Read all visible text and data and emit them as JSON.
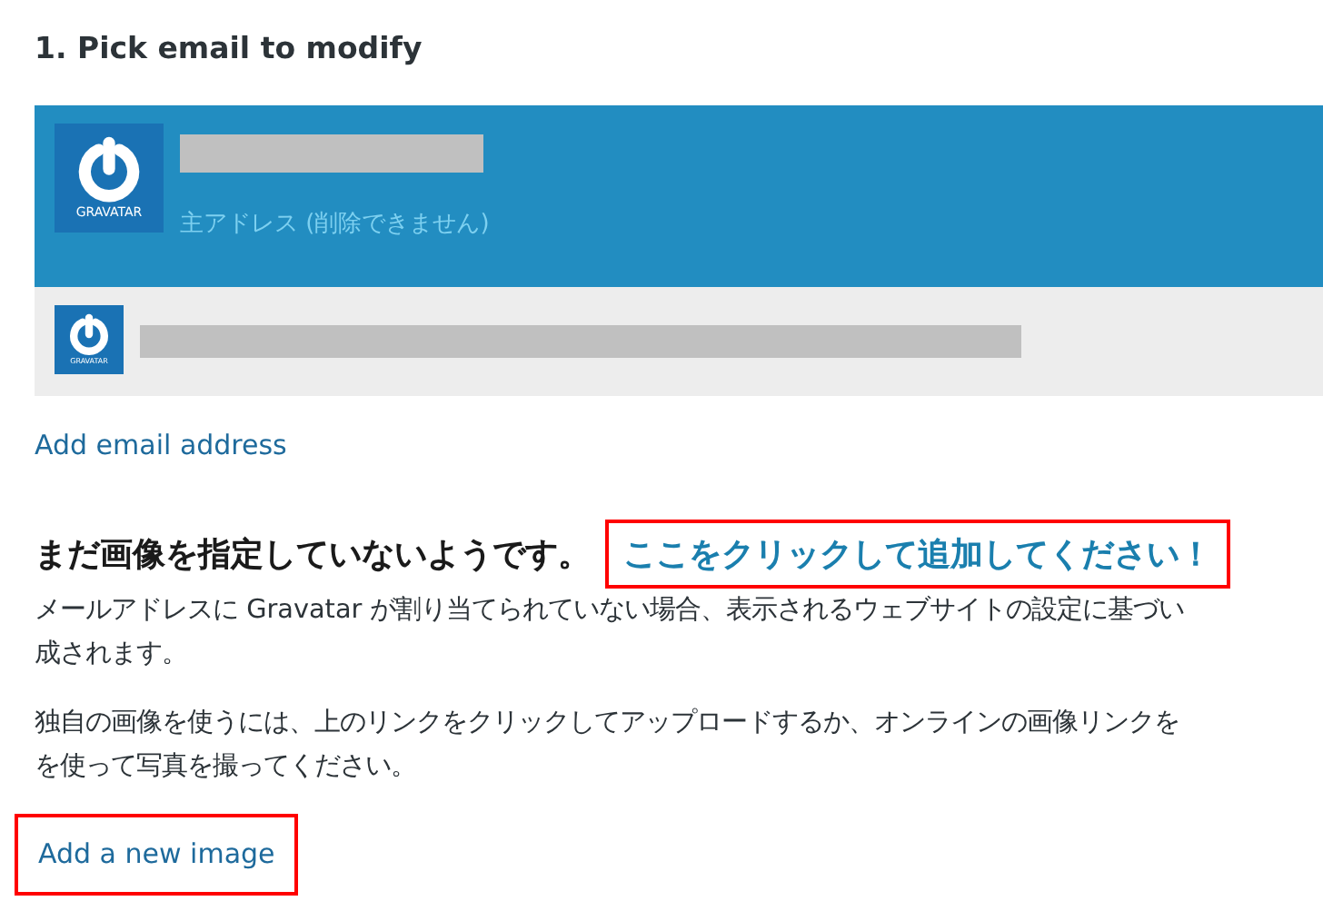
{
  "section_title": "1. Pick email to modify",
  "emails": [
    {
      "logo_text": "GRAVATAR",
      "note": "主アドレス (削除できません)",
      "selected": true
    },
    {
      "logo_text": "GRAVATAR",
      "selected": false
    }
  ],
  "add_email_link": "Add email address",
  "notice": {
    "heading": "まだ画像を指定していないようです。",
    "link": "ここをクリックして追加してください！",
    "link_highlighted": true
  },
  "paragraphs": [
    {
      "lines": [
        "メールアドレスに Gravatar が割り当てられていない場合、表示されるウェブサイトの設定に基づい",
        "成されます。"
      ]
    },
    {
      "lines": [
        "独自の画像を使うには、上のリンクをクリックしてアップロードするか、オンラインの画像リンクを",
        "を使って写真を撮ってください。"
      ]
    }
  ],
  "add_image_link": {
    "label": "Add a new image",
    "highlighted": true
  }
}
